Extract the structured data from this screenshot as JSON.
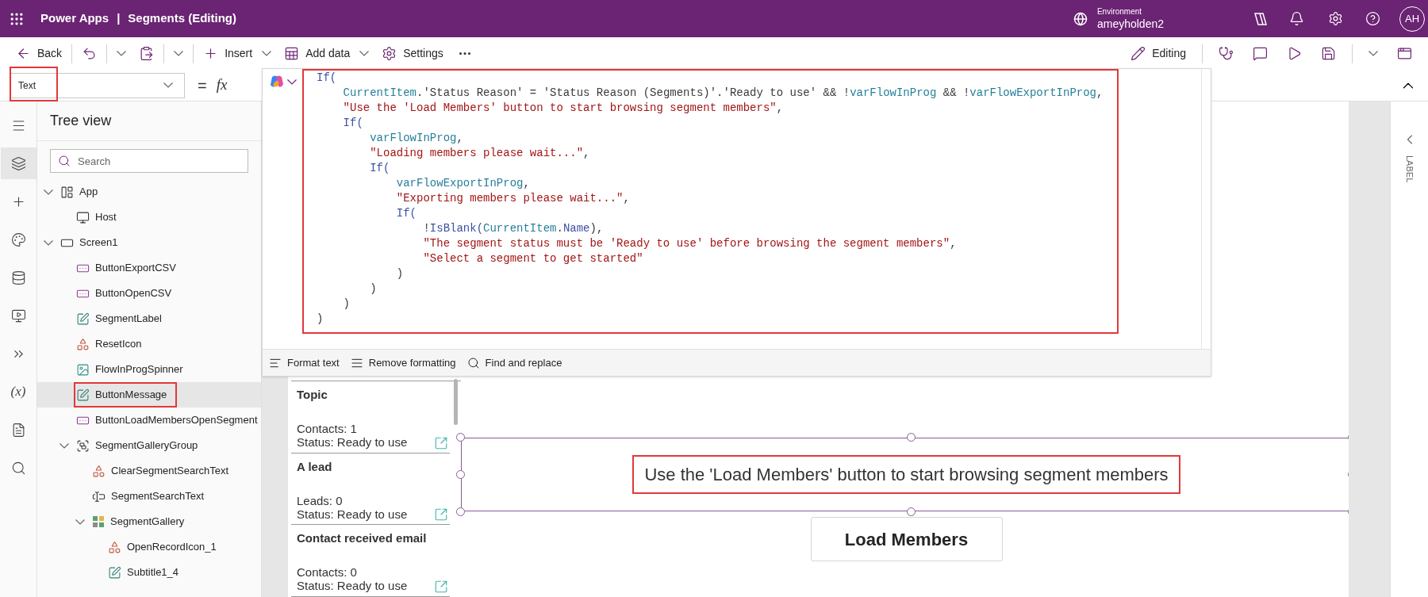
{
  "header": {
    "app_name": "Power Apps",
    "separator": "|",
    "document": "Segments (Editing)",
    "environment_label": "Environment",
    "environment": "ameyholden2",
    "avatar_initials": "AH"
  },
  "toolbar": {
    "left": [
      {
        "kind": "back",
        "label": "Back"
      },
      {
        "kind": "divider"
      },
      {
        "kind": "undo"
      },
      {
        "kind": "divider"
      },
      {
        "kind": "caret"
      },
      {
        "kind": "paste"
      },
      {
        "kind": "divider"
      },
      {
        "kind": "caret"
      },
      {
        "kind": "divider"
      },
      {
        "kind": "insert",
        "label": "Insert",
        "caret": true
      },
      {
        "kind": "adddata",
        "label": "Add data",
        "caret": true
      },
      {
        "kind": "settings",
        "label": "Settings",
        "caret": false
      },
      {
        "kind": "more"
      }
    ],
    "right": [
      {
        "kind": "editing",
        "label": "Editing"
      },
      {
        "kind": "divider"
      },
      {
        "kind": "checker"
      },
      {
        "kind": "comments"
      },
      {
        "kind": "play"
      },
      {
        "kind": "save"
      },
      {
        "kind": "divider"
      },
      {
        "kind": "caret"
      },
      {
        "kind": "publish"
      }
    ]
  },
  "formula_bar": {
    "property": "Text",
    "property_highlighted": true,
    "equals": "=",
    "fx": "fx",
    "code_highlighted": true,
    "lines": [
      [
        {
          "kind": "fn",
          "text": "If("
        }
      ],
      [
        {
          "kind": "ident",
          "text": "    CurrentItem"
        },
        {
          "kind": "plain",
          "text": ".'Status Reason' = 'Status Reason (Segments)'.'Ready to use' && !"
        },
        {
          "kind": "ident",
          "text": "varFlowInProg"
        },
        {
          "kind": "plain",
          "text": " && !"
        },
        {
          "kind": "ident",
          "text": "varFlowExportInProg"
        },
        {
          "kind": "plain",
          "text": ","
        }
      ],
      [
        {
          "kind": "str",
          "text": "    \"Use the 'Load Members' button to start browsing segment members\""
        },
        {
          "kind": "plain",
          "text": ","
        }
      ],
      [
        {
          "kind": "fn",
          "text": "    If("
        }
      ],
      [
        {
          "kind": "ident",
          "text": "        varFlowInProg"
        },
        {
          "kind": "plain",
          "text": ","
        }
      ],
      [
        {
          "kind": "str",
          "text": "        \"Loading members please wait...\""
        },
        {
          "kind": "plain",
          "text": ","
        }
      ],
      [
        {
          "kind": "fn",
          "text": "        If("
        }
      ],
      [
        {
          "kind": "ident",
          "text": "            varFlowExportInProg"
        },
        {
          "kind": "plain",
          "text": ","
        }
      ],
      [
        {
          "kind": "str",
          "text": "            \"Exporting members please wait...\""
        },
        {
          "kind": "plain",
          "text": ","
        }
      ],
      [
        {
          "kind": "fn",
          "text": "            If("
        }
      ],
      [
        {
          "kind": "plain",
          "text": "                !"
        },
        {
          "kind": "fn",
          "text": "IsBlank("
        },
        {
          "kind": "ident",
          "text": "CurrentItem"
        },
        {
          "kind": "plain",
          "text": "."
        },
        {
          "kind": "fn",
          "text": "Name"
        },
        {
          "kind": "plain",
          "text": "),"
        }
      ],
      [
        {
          "kind": "str",
          "text": "                \"The segment status must be 'Ready to use' before browsing the segment members\""
        },
        {
          "kind": "plain",
          "text": ","
        }
      ],
      [
        {
          "kind": "str",
          "text": "                \"Select a segment to get started\""
        }
      ],
      [
        {
          "kind": "plain",
          "text": "            )"
        }
      ],
      [
        {
          "kind": "plain",
          "text": "        )"
        }
      ],
      [
        {
          "kind": "plain",
          "text": "    )"
        }
      ],
      [
        {
          "kind": "plain",
          "text": ")"
        }
      ]
    ],
    "footer": [
      {
        "kind": "format",
        "label": "Format text"
      },
      {
        "kind": "remove",
        "label": "Remove formatting"
      },
      {
        "kind": "find",
        "label": "Find and replace"
      }
    ]
  },
  "rail": [
    {
      "kind": "menu",
      "selected": false
    },
    {
      "kind": "layers",
      "selected": true
    },
    {
      "kind": "plus",
      "selected": false
    },
    {
      "kind": "palette",
      "selected": false
    },
    {
      "kind": "database",
      "selected": false
    },
    {
      "kind": "media",
      "selected": false
    },
    {
      "kind": "flows",
      "selected": false
    },
    {
      "kind": "variables",
      "label": "(x)",
      "selected": false
    },
    {
      "kind": "document",
      "selected": false
    },
    {
      "kind": "search",
      "selected": false
    }
  ],
  "tree": {
    "title": "Tree view",
    "search_placeholder": "Search",
    "items": [
      {
        "kind": "app",
        "label": "App",
        "expanded": true,
        "selected": false,
        "highlighted": false,
        "children": [
          {
            "kind": "host",
            "label": "Host",
            "selected": false,
            "highlighted": false
          }
        ]
      },
      {
        "kind": "screen",
        "label": "Screen1",
        "expanded": true,
        "selected": false,
        "highlighted": false,
        "children": [
          {
            "kind": "button",
            "label": "ButtonExportCSV",
            "selected": false,
            "highlighted": false
          },
          {
            "kind": "button",
            "label": "ButtonOpenCSV",
            "selected": false,
            "highlighted": false
          },
          {
            "kind": "label",
            "label": "SegmentLabel",
            "selected": false,
            "highlighted": false
          },
          {
            "kind": "icon",
            "label": "ResetIcon",
            "selected": false,
            "highlighted": false
          },
          {
            "kind": "image",
            "label": "FlowInProgSpinner",
            "selected": false,
            "highlighted": false
          },
          {
            "kind": "label",
            "label": "ButtonMessage",
            "selected": true,
            "highlighted": true
          },
          {
            "kind": "button",
            "label": "ButtonLoadMembersOpenSegment",
            "selected": false,
            "highlighted": false
          },
          {
            "kind": "group",
            "label": "SegmentGalleryGroup",
            "expanded": true,
            "selected": false,
            "highlighted": false,
            "children": [
              {
                "kind": "icon",
                "label": "ClearSegmentSearchText",
                "selected": false,
                "highlighted": false
              },
              {
                "kind": "textinput",
                "label": "SegmentSearchText",
                "selected": false,
                "highlighted": false
              },
              {
                "kind": "gallery",
                "label": "SegmentGallery",
                "expanded": true,
                "selected": false,
                "highlighted": false,
                "children": [
                  {
                    "kind": "icon",
                    "label": "OpenRecordIcon_1",
                    "selected": false,
                    "highlighted": false
                  },
                  {
                    "kind": "label",
                    "label": "Subtitle1_4",
                    "selected": false,
                    "highlighted": false
                  }
                ]
              }
            ]
          }
        ]
      }
    ]
  },
  "canvas": {
    "gallery": [
      {
        "title": "Topic",
        "count": "Contacts: 1",
        "status": "Status: Ready to use"
      },
      {
        "title": "A lead",
        "count": "Leads: 0",
        "status": "Status: Ready to use"
      },
      {
        "title": "Contact received email",
        "count": "Contacts: 0",
        "status": "Status: Ready to use"
      }
    ],
    "label": {
      "text": "Use the 'Load Members' button to start browsing segment members",
      "selected": true,
      "highlighted": true
    },
    "button": "Load Members"
  },
  "right_panel": {
    "label": "LABEL"
  }
}
